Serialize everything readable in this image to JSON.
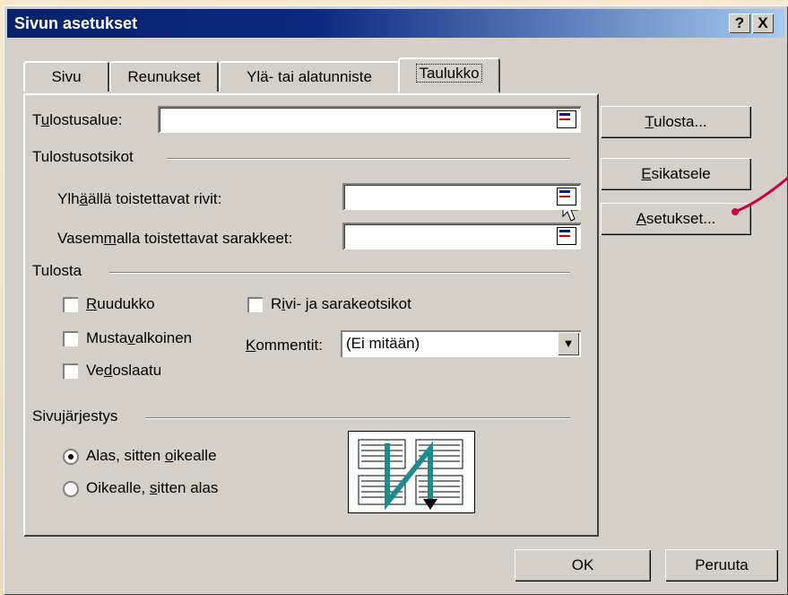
{
  "dialog": {
    "title": "Sivun asetukset",
    "help_button": "?",
    "close_button": "X"
  },
  "tabs": [
    {
      "label": "Sivu"
    },
    {
      "label": "Reunukset"
    },
    {
      "label": "Ylä- tai alatunniste"
    },
    {
      "label": "Taulukko",
      "active": true
    }
  ],
  "print_area": {
    "label": "Tulostusalue:",
    "value": ""
  },
  "print_titles": {
    "group_label": "Tulostusotsikot",
    "rows_label": "Ylhäällä toistettavat rivit:",
    "rows_value": "",
    "cols_label": "Vasemmalla toistettavat sarakkeet:",
    "cols_value": ""
  },
  "print": {
    "group_label": "Tulosta",
    "gridlines": {
      "label": "Ruudukko",
      "checked": false
    },
    "black_white": {
      "label": "Mustavalkoinen",
      "checked": false
    },
    "draft": {
      "label": "Vedoslaatu",
      "checked": false
    },
    "row_col_headings": {
      "label": "Rivi- ja sarakeotsikot",
      "checked": false
    },
    "comments_label": "Kommentit:",
    "comments_value": "(Ei mitään)"
  },
  "page_order": {
    "group_label": "Sivujärjestys",
    "option1": {
      "label": "Alas, sitten oikealle",
      "selected": true
    },
    "option2": {
      "label": "Oikealle, sitten alas",
      "selected": false
    }
  },
  "side_buttons": {
    "print": "Tulosta...",
    "preview": "Esikatsele",
    "options": "Asetukset..."
  },
  "footer_buttons": {
    "ok": "OK",
    "cancel": "Peruuta"
  },
  "colors": {
    "title_bar": "#08246b",
    "dialog_face": "#d4d0c8",
    "annotation_arrow": "#c8004a",
    "diagram_arrow": "#1f8a8a"
  }
}
